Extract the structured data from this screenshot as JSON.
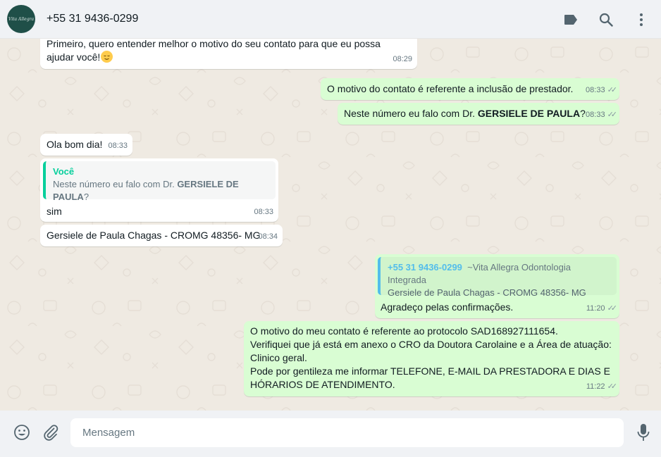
{
  "header": {
    "avatar_text": "Vita Allegra",
    "contact_name": "+55 31 9436-0299",
    "icons": [
      "label-icon",
      "search-icon",
      "menu-icon"
    ]
  },
  "messages": [
    {
      "dir": "in",
      "line1": "Primeiro, quero entender melhor o motivo do seu contato para que eu possa",
      "line2": "ajudar você!",
      "emoji": "relieved-face",
      "time": "08:29"
    },
    {
      "dir": "out",
      "text": "O motivo do contato é referente a inclusão de prestador.",
      "time": "08:33"
    },
    {
      "dir": "out",
      "text_before": "Neste número eu falo com Dr. ",
      "text_bold": "GERSIELE DE PAULA",
      "text_after": "?",
      "time": "08:33"
    },
    {
      "dir": "in",
      "text": "Ola bom dia!",
      "time": "08:33"
    },
    {
      "dir": "in",
      "quote_author": "Você",
      "quote_before": "Neste número eu falo com Dr. ",
      "quote_bold": "GERSIELE DE PAULA",
      "quote_after": "?",
      "text": "sim",
      "time": "08:33"
    },
    {
      "dir": "in",
      "text": "Gersiele de Paula Chagas - CROMG 48356- MG",
      "time": "08:34"
    },
    {
      "dir": "out",
      "quote_author": "+55 31 9436-0299",
      "quote_author_sub": "~Vita Allegra Odontologia Integrada",
      "quote_text": "Gersiele de Paula Chagas - CROMG 48356- MG",
      "text": "Agradeço pelas confirmações.",
      "time": "11:20"
    },
    {
      "dir": "out",
      "lines": [
        "O motivo do meu contato é referente ao protocolo SAD168927111654.",
        "Verifiquei que já está em anexo o CRO da Doutora Carolaine e a Área de atuação:",
        "Clinico geral.",
        "Pode por gentileza me informar TELEFONE, E-MAIL DA PRESTADORA E DIAS E",
        "HÓRARIOS DE ATENDIMENTO."
      ],
      "time": "11:22"
    }
  ],
  "composer": {
    "placeholder": "Mensagem",
    "icons": [
      "emoji-icon",
      "attach-icon",
      "microphone-icon"
    ]
  },
  "colors": {
    "incoming_bubble": "#ffffff",
    "outgoing_bubble": "#d9fdd3",
    "chat_background": "#efeae2",
    "header_background": "#f0f2f5",
    "quote_accent_you": "#06cf9c",
    "quote_accent_contact": "#53bdeb"
  }
}
